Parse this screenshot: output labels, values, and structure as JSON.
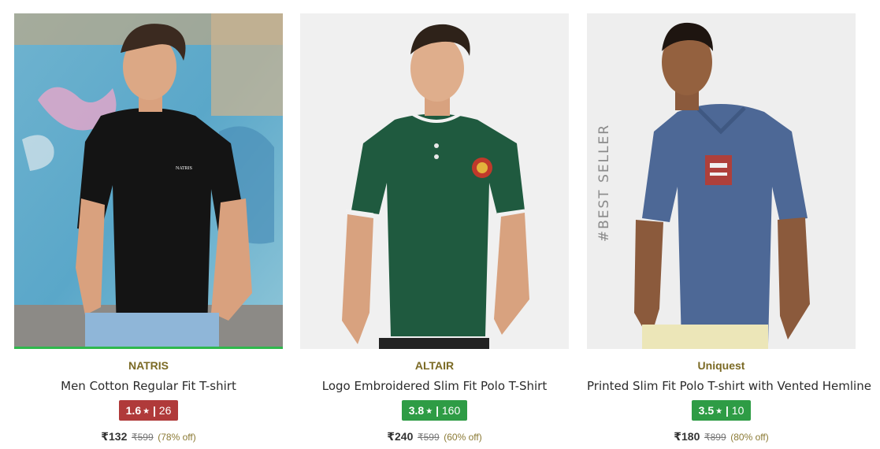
{
  "products": [
    {
      "brand": "NATRIS",
      "title": "Men Cotton Regular Fit T-shirt",
      "rating": "1.6",
      "star": "★",
      "separator": "|",
      "rating_count": "26",
      "rating_color": "#b03a3a",
      "price": "₹132",
      "mrp": "₹599",
      "discount": "(78% off)",
      "chest_logo": "NATRIS"
    },
    {
      "brand": "ALTAIR",
      "title": "Logo Embroidered Slim Fit Polo T-Shirt",
      "rating": "3.8",
      "star": "★",
      "separator": "|",
      "rating_count": "160",
      "rating_color": "#2e9c45",
      "price": "₹240",
      "mrp": "₹599",
      "discount": "(60% off)"
    },
    {
      "brand": "Uniquest",
      "title": "Printed Slim Fit Polo T-shirt with Vented Hemline",
      "rating": "3.5",
      "star": "★",
      "separator": "|",
      "rating_count": "10",
      "rating_color": "#2e9c45",
      "price": "₹180",
      "mrp": "₹899",
      "discount": "(80% off)",
      "tag": "#BEST SELLER"
    }
  ],
  "colors": {
    "brand_text": "#7b6a25",
    "selected_border": "#2fb84d",
    "shirt_black": "#141414",
    "shirt_green": "#1f5a3f",
    "shirt_blue": "#4d6896"
  }
}
